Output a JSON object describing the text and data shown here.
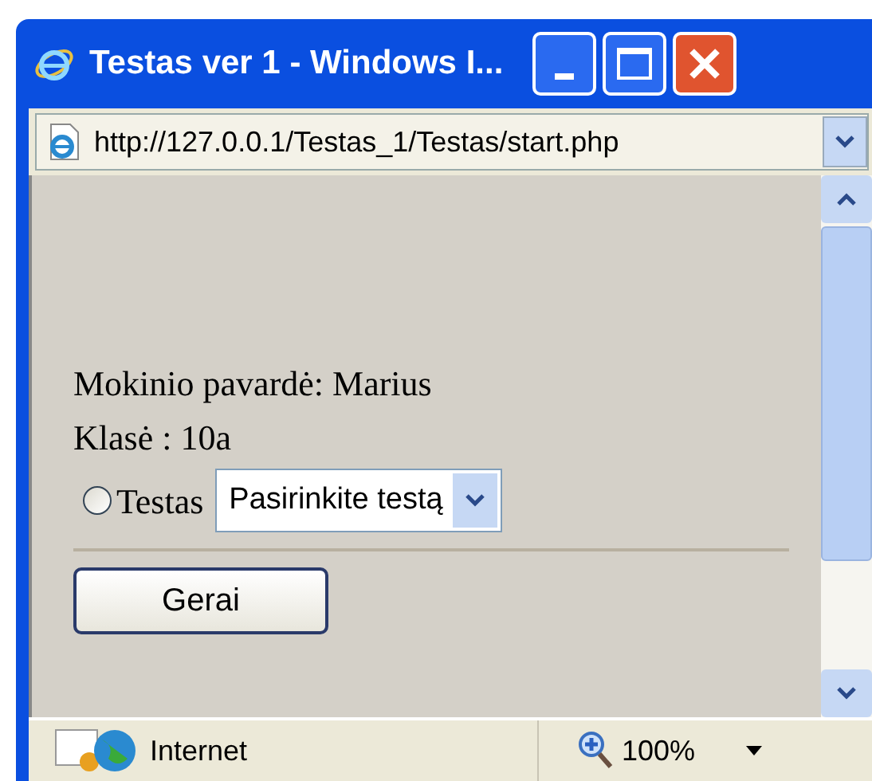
{
  "window": {
    "title": "Testas ver 1 - Windows I..."
  },
  "address_bar": {
    "url": "http://127.0.0.1/Testas_1/Testas/start.php"
  },
  "page": {
    "student_line": "Mokinio pavardė: Marius",
    "class_line": "Klasė : 10a",
    "test_option": {
      "label": "Testas",
      "selected": false
    },
    "test_select": {
      "value": "Pasirinkite testą"
    },
    "button": "Gerai"
  },
  "status_bar": {
    "zone": "Internet",
    "zoom": "100%"
  }
}
